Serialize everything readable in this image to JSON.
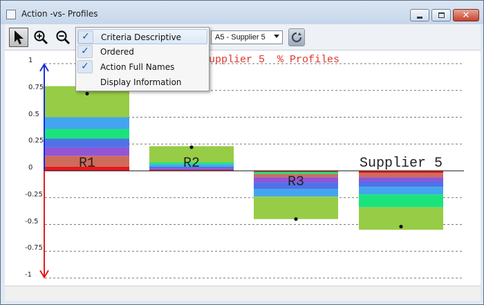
{
  "window": {
    "title": "Action -vs- Profiles"
  },
  "toolbar": {
    "tools": [
      {
        "name": "pointer-icon"
      },
      {
        "name": "zoom-in-icon"
      },
      {
        "name": "zoom-out-icon"
      }
    ],
    "action_select": "A5 - Supplier 5",
    "refresh_icon": "refresh-icon"
  },
  "menu": {
    "items": [
      {
        "label": "Criteria Descriptive",
        "checked": true
      },
      {
        "label": "Ordered",
        "checked": true
      },
      {
        "label": "Action Full Names",
        "checked": true
      },
      {
        "label": "Display Information",
        "checked": false
      }
    ]
  },
  "chart": {
    "title": "Supplier 5  % Profiles",
    "yticks": [
      "1",
      "0.75",
      "0.5",
      "0.25",
      "0",
      "-0.25",
      "-0.5",
      "-0.75",
      "-1"
    ]
  },
  "chart_data": {
    "type": "bar",
    "ylim": [
      -1,
      1
    ],
    "grid": true,
    "categories": [
      "R1",
      "R2",
      "R3",
      "Supplier 5"
    ],
    "net_values": [
      0.72,
      0.22,
      -0.45,
      -0.52
    ],
    "stacks": [
      [
        {
          "value": 0.04,
          "color": "#e8191e"
        },
        {
          "value": 0.1,
          "color": "#cf6b5a"
        },
        {
          "value": 0.08,
          "color": "#9056d4"
        },
        {
          "value": 0.08,
          "color": "#4e72e8"
        },
        {
          "value": 0.09,
          "color": "#1be37c"
        },
        {
          "value": 0.11,
          "color": "#43a5ef"
        },
        {
          "value": 0.29,
          "color": "#97cc46"
        }
      ],
      [
        {
          "value": 0.01,
          "color": "#e8191e"
        },
        {
          "value": 0.01,
          "color": "#9056d4"
        },
        {
          "value": 0.02,
          "color": "#4e72e8"
        },
        {
          "value": 0.02,
          "color": "#43a5ef"
        },
        {
          "value": 0.02,
          "color": "#1be37c"
        },
        {
          "value": 0.15,
          "color": "#97cc46"
        }
      ],
      [
        {
          "value": -0.01,
          "color": "#e8191e"
        },
        {
          "value": -0.02,
          "color": "#1be37c"
        },
        {
          "value": -0.03,
          "color": "#cf6b5a"
        },
        {
          "value": -0.05,
          "color": "#9056d4"
        },
        {
          "value": -0.06,
          "color": "#4e72e8"
        },
        {
          "value": -0.07,
          "color": "#43a5ef"
        },
        {
          "value": -0.21,
          "color": "#97cc46"
        }
      ],
      [
        {
          "value": -0.02,
          "color": "#e8191e"
        },
        {
          "value": -0.04,
          "color": "#cf6b5a"
        },
        {
          "value": -0.04,
          "color": "#9056d4"
        },
        {
          "value": -0.05,
          "color": "#4e72e8"
        },
        {
          "value": -0.07,
          "color": "#43a5ef"
        },
        {
          "value": -0.12,
          "color": "#1be37c"
        },
        {
          "value": -0.21,
          "color": "#97cc46"
        }
      ]
    ]
  }
}
